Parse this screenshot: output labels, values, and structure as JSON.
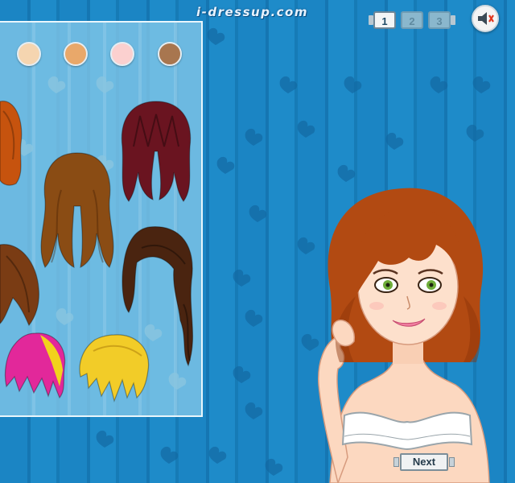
{
  "site": {
    "brand": "i-dressup.com"
  },
  "skin_tones": [
    {
      "color": "#f5d5b0"
    },
    {
      "color": "#e9a86a"
    },
    {
      "color": "#fbd0cf"
    },
    {
      "color": "#a8764f"
    }
  ],
  "hairstyles": [
    {
      "style": "partial-orange-long",
      "color": "#c6530e"
    },
    {
      "style": "burgundy-bangs-long",
      "color": "#6a1420"
    },
    {
      "style": "brown-wavy-long",
      "color": "#8a4c14"
    },
    {
      "style": "dark-brown-side-curly",
      "color": "#4a2410"
    },
    {
      "style": "partial-brown-short",
      "color": "#7a3c14"
    },
    {
      "style": "pink-yellow-spiky",
      "color": "#e2289a"
    },
    {
      "style": "blonde-short",
      "color": "#f2cc28"
    }
  ],
  "pagination": {
    "pages": [
      "1",
      "2",
      "3"
    ],
    "current": "1"
  },
  "sound": {
    "icon": "speaker-mute-icon"
  },
  "doll": {
    "hair_color": "#b24a12",
    "eye_color": "#6fae3a",
    "top_color": "#ffffff"
  },
  "buttons": {
    "next_label": "Next"
  },
  "colors": {
    "background": "#1a82c0",
    "panel": "#8ccdeb"
  }
}
